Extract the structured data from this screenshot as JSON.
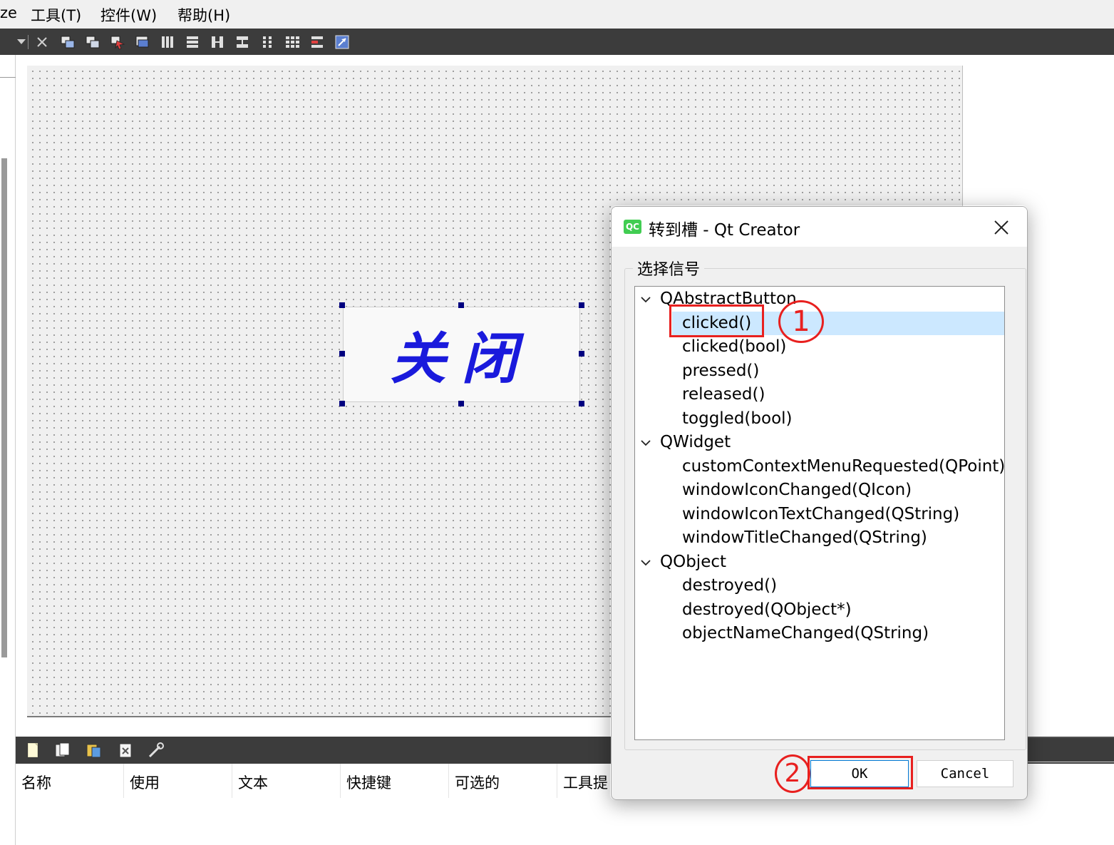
{
  "menubar": {
    "items": [
      "ze",
      "工具(T)",
      "控件(W)",
      "帮助(H)"
    ]
  },
  "toolbar": {
    "icons": [
      "dropdown-arrow-icon",
      "close-icon",
      "edit-widgets-icon",
      "edit-signals-slots-icon",
      "edit-buddies-icon",
      "edit-tab-order-icon",
      "layout-horizontal-icon",
      "layout-vertical-icon",
      "layout-horizontal-splitter-icon",
      "layout-vertical-splitter-icon",
      "layout-grid-icon",
      "layout-form-icon",
      "break-layout-icon",
      "adjust-size-icon"
    ]
  },
  "form": {
    "button_text": "关闭",
    "button_text_color": "#1a1adc"
  },
  "action_editor": {
    "columns": [
      "名称",
      "使用",
      "文本",
      "快捷键",
      "可选的",
      "工具提"
    ]
  },
  "dialog": {
    "title": "转到槽 - Qt Creator",
    "group_label": "选择信号",
    "tree": [
      {
        "label": "QAbstractButton",
        "type": "group"
      },
      {
        "label": "clicked()",
        "type": "leaf",
        "selected": true
      },
      {
        "label": "clicked(bool)",
        "type": "leaf"
      },
      {
        "label": "pressed()",
        "type": "leaf"
      },
      {
        "label": "released()",
        "type": "leaf"
      },
      {
        "label": "toggled(bool)",
        "type": "leaf"
      },
      {
        "label": "QWidget",
        "type": "group"
      },
      {
        "label": "customContextMenuRequested(QPoint)",
        "type": "leaf"
      },
      {
        "label": "windowIconChanged(QIcon)",
        "type": "leaf"
      },
      {
        "label": "windowIconTextChanged(QString)",
        "type": "leaf"
      },
      {
        "label": "windowTitleChanged(QString)",
        "type": "leaf"
      },
      {
        "label": "QObject",
        "type": "group"
      },
      {
        "label": "destroyed()",
        "type": "leaf"
      },
      {
        "label": "destroyed(QObject*)",
        "type": "leaf"
      },
      {
        "label": "objectNameChanged(QString)",
        "type": "leaf"
      }
    ],
    "ok_label": "OK",
    "cancel_label": "Cancel"
  },
  "annotations": {
    "step1": "1",
    "step2": "2",
    "color": "#e8201f"
  },
  "colors": {
    "selection": "#cce8ff",
    "toolbar_bg": "#3c3c3c",
    "qt_green": "#41cd52"
  }
}
